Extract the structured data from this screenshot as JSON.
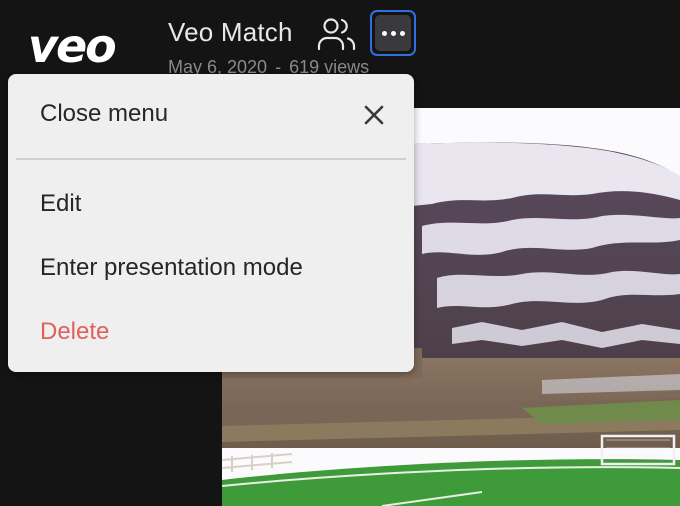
{
  "header": {
    "logo_text": "veo",
    "title": "Veo Match",
    "date": "May 6, 2020",
    "separator": "-",
    "views": "619 views",
    "icons": {
      "users": "users-icon",
      "more": "more-options-icon"
    }
  },
  "menu": {
    "close_label": "Close menu",
    "close_icon": "close-icon",
    "items": [
      {
        "label": "Edit"
      },
      {
        "label": "Enter presentation mode"
      },
      {
        "label": "Delete",
        "variant": "danger"
      }
    ]
  },
  "colors": {
    "background": "#141414",
    "accent_focus": "#2f6fe0",
    "danger": "#e0605c",
    "menu_bg": "#efefef"
  }
}
